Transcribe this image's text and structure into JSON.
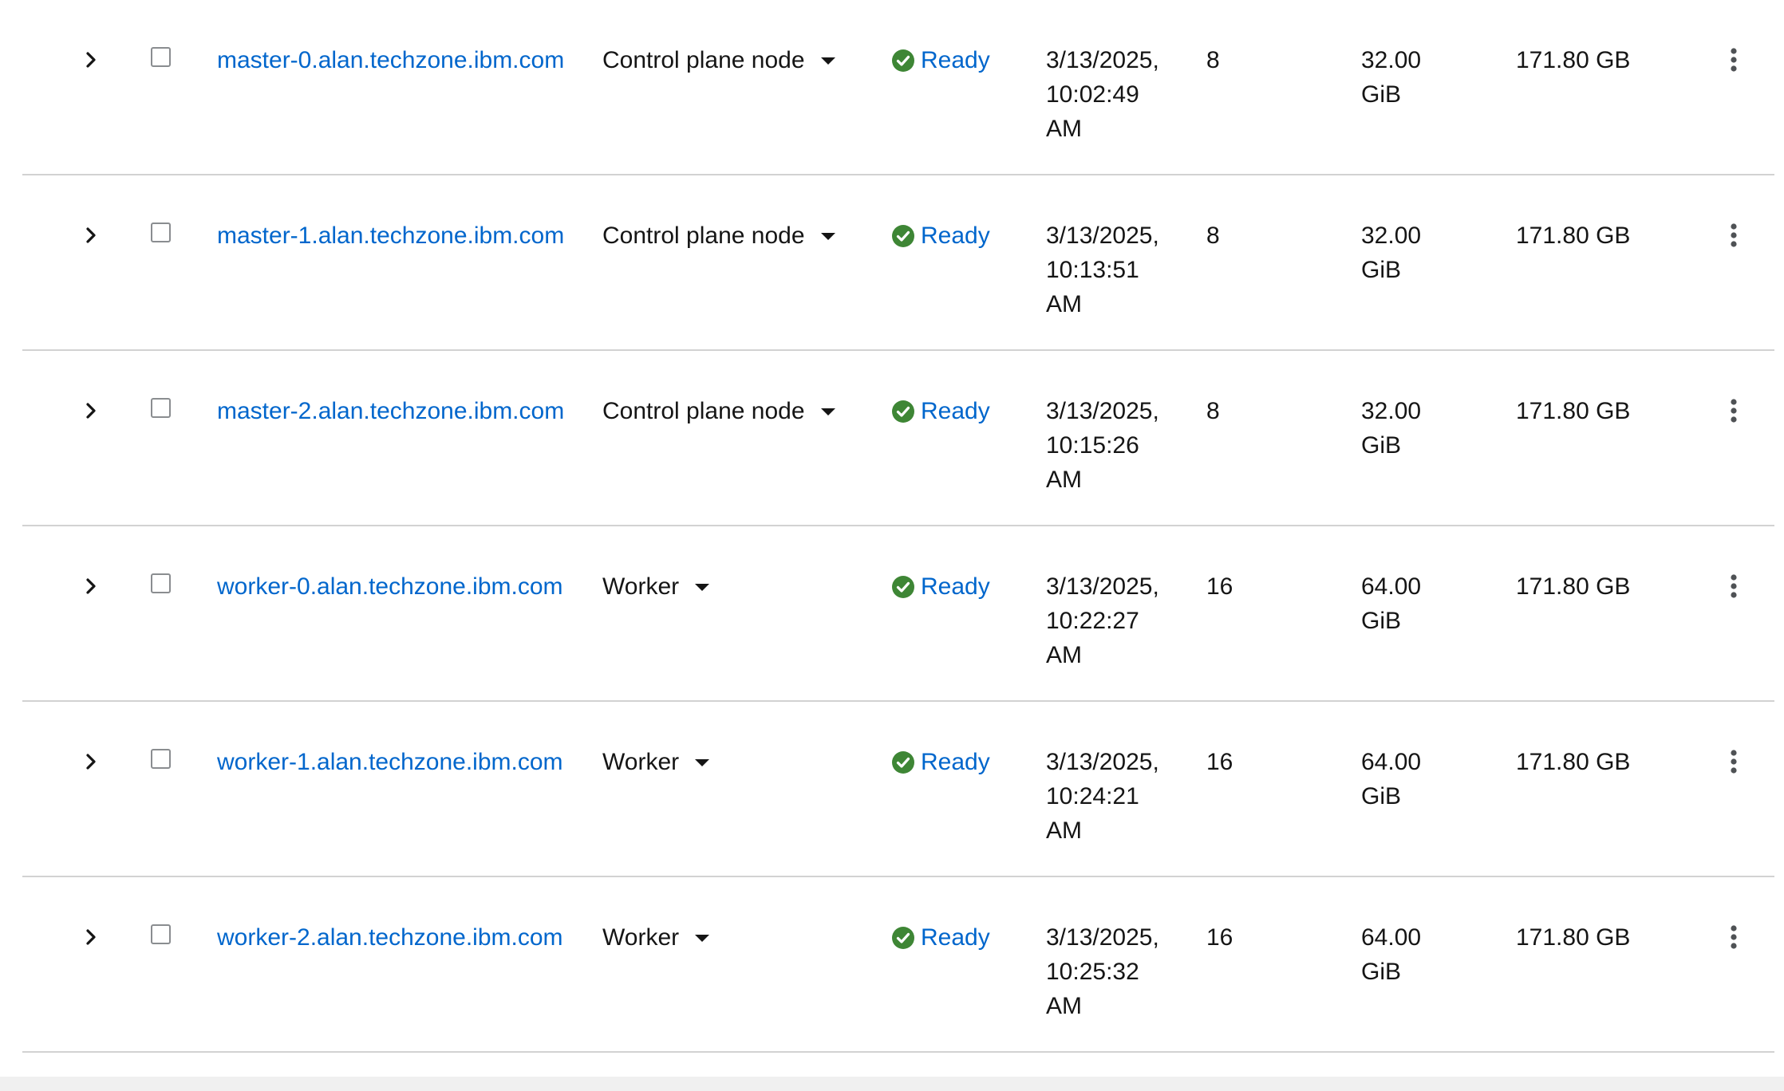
{
  "theme": {
    "link_color": "#0066cc",
    "success_color": "#3e8635",
    "divider_color": "#d2d2d2"
  },
  "icons": {
    "expand": "chevron-right-icon",
    "status": "check-circle-icon",
    "role_toggle": "caret-down-icon",
    "actions": "kebab-icon"
  },
  "nodes": [
    {
      "name": "master-0.alan.techzone.ibm.com",
      "role": "Control plane node",
      "status": "Ready",
      "created": "3/13/2025, 10:02:49 AM",
      "cpu": "8",
      "memory": "32.00 GiB",
      "storage": "171.80 GB"
    },
    {
      "name": "master-1.alan.techzone.ibm.com",
      "role": "Control plane node",
      "status": "Ready",
      "created": "3/13/2025, 10:13:51 AM",
      "cpu": "8",
      "memory": "32.00 GiB",
      "storage": "171.80 GB"
    },
    {
      "name": "master-2.alan.techzone.ibm.com",
      "role": "Control plane node",
      "status": "Ready",
      "created": "3/13/2025, 10:15:26 AM",
      "cpu": "8",
      "memory": "32.00 GiB",
      "storage": "171.80 GB"
    },
    {
      "name": "worker-0.alan.techzone.ibm.com",
      "role": "Worker",
      "status": "Ready",
      "created": "3/13/2025, 10:22:27 AM",
      "cpu": "16",
      "memory": "64.00 GiB",
      "storage": "171.80 GB"
    },
    {
      "name": "worker-1.alan.techzone.ibm.com",
      "role": "Worker",
      "status": "Ready",
      "created": "3/13/2025, 10:24:21 AM",
      "cpu": "16",
      "memory": "64.00 GiB",
      "storage": "171.80 GB"
    },
    {
      "name": "worker-2.alan.techzone.ibm.com",
      "role": "Worker",
      "status": "Ready",
      "created": "3/13/2025, 10:25:32 AM",
      "cpu": "16",
      "memory": "64.00 GiB",
      "storage": "171.80 GB"
    }
  ]
}
